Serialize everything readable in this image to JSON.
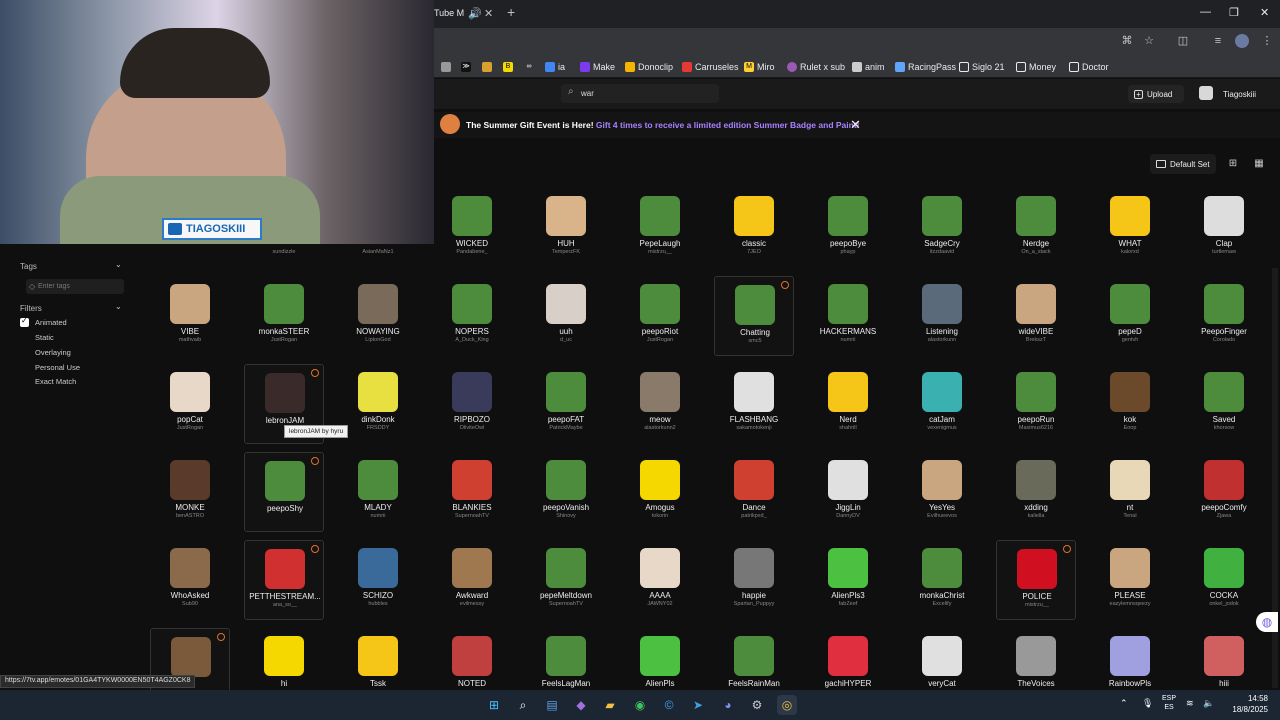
{
  "browser": {
    "tab_title": "Tube M",
    "address_icons": [
      "translate-icon",
      "star-icon",
      "extensions-icon",
      "menu-icon"
    ],
    "bookmarks": [
      {
        "label": "ia",
        "color": "#4285f4"
      },
      {
        "label": "Make",
        "color": "#7c3aed"
      },
      {
        "label": "Donoclip",
        "color": "#f5b400"
      },
      {
        "label": "Carruseles",
        "color": "#e53935"
      },
      {
        "label": "Miro",
        "color": "#ffd02f"
      },
      {
        "label": "Rulet x sub",
        "color": "#9b59b6"
      },
      {
        "label": "anim",
        "color": "#cccccc"
      },
      {
        "label": "RacingPass",
        "color": "#60a5fa"
      },
      {
        "label": "Siglo 21",
        "color": "#e8eaed"
      },
      {
        "label": "Money",
        "color": "#e8eaed"
      },
      {
        "label": "Doctor",
        "color": "#e8eaed"
      }
    ]
  },
  "header": {
    "search_value": "war",
    "upload_label": "Upload",
    "user_name": "Tiagoskiii"
  },
  "banner": {
    "title": "The Summer Gift Event is Here!",
    "link": "Gift 4 times to receive a limited edition Summer Badge and Paint!"
  },
  "toolbar": {
    "set_label": "Default Set"
  },
  "sidebar": {
    "tags_label": "Tags",
    "tags_placeholder": "Enter tags",
    "filters_label": "Filters",
    "filters": [
      {
        "label": "Animated",
        "checked": true
      },
      {
        "label": "Static",
        "checked": false
      },
      {
        "label": "Overlaying",
        "checked": false
      },
      {
        "label": "Personal Use",
        "checked": false
      },
      {
        "label": "Exact Match",
        "checked": false
      }
    ]
  },
  "emotes": [
    {
      "name": "",
      "author": "",
      "color": "#222"
    },
    {
      "name": "",
      "author": "sundizzle",
      "color": "#222"
    },
    {
      "name": "",
      "author": "AsianMaNz1",
      "color": "#222"
    },
    {
      "name": "WICKED",
      "author": "Pandabene_",
      "color": "#4c8c3c"
    },
    {
      "name": "HUH",
      "author": "TemperzFK",
      "color": "#d9b48a"
    },
    {
      "name": "PepeLaugh",
      "author": "mistrzu__",
      "color": "#4c8c3c"
    },
    {
      "name": "classic",
      "author": "7JEO",
      "color": "#f5c518"
    },
    {
      "name": "peepoBye",
      "author": "phayp",
      "color": "#4c8c3c"
    },
    {
      "name": "SadgeCry",
      "author": "itzzdaavid",
      "color": "#4c8c3c"
    },
    {
      "name": "Nerdge",
      "author": "On_a_stack",
      "color": "#4c8c3c"
    },
    {
      "name": "WHAT",
      "author": "kalorxd",
      "color": "#f5c518"
    },
    {
      "name": "Clap",
      "author": "turtlemaw",
      "color": "#dddddd"
    },
    {
      "name": "VIBE",
      "author": "mathvaib",
      "color": "#c9a680"
    },
    {
      "name": "monkaSTEER",
      "author": "JustRogan",
      "color": "#4c8c3c"
    },
    {
      "name": "NOWAYING",
      "author": "LiptonGod",
      "color": "#7a6a5a"
    },
    {
      "name": "NOPERS",
      "author": "A_Duck_King",
      "color": "#4c8c3c"
    },
    {
      "name": "uuh",
      "author": "d_uc",
      "color": "#d8d0c8"
    },
    {
      "name": "peepoRiot",
      "author": "JustRogan",
      "color": "#4c8c3c"
    },
    {
      "name": "Chatting",
      "author": "smc5",
      "color": "#4c8c3c",
      "highlight": true
    },
    {
      "name": "HACKERMANS",
      "author": "numrii",
      "color": "#4c8c3c"
    },
    {
      "name": "Listening",
      "author": "alastorkunn",
      "color": "#5a6a7a"
    },
    {
      "name": "wideVIBE",
      "author": "BrekszT",
      "color": "#c9a680"
    },
    {
      "name": "pepeD",
      "author": "gentvh",
      "color": "#4c8c3c"
    },
    {
      "name": "PeepoFinger",
      "author": "Corolado",
      "color": "#4c8c3c"
    },
    {
      "name": "popCat",
      "author": "JustRogan",
      "color": "#e8d8c8"
    },
    {
      "name": "lebronJAM",
      "author": "",
      "color": "#3a2a2a",
      "highlight": true
    },
    {
      "name": "dinkDonk",
      "author": "FRSDDY",
      "color": "#e8e040"
    },
    {
      "name": "RIPBOZO",
      "author": "OliviteOwl",
      "color": "#3a3a5a"
    },
    {
      "name": "peepoFAT",
      "author": "PatrickMaybe",
      "color": "#4c8c3c"
    },
    {
      "name": "meow",
      "author": "alastorkunn2",
      "color": "#8a7a6a"
    },
    {
      "name": "FLASHBANG",
      "author": "sakamotokenji",
      "color": "#e0e0e0"
    },
    {
      "name": "Nerd",
      "author": "shahrill",
      "color": "#f5c518"
    },
    {
      "name": "catJam",
      "author": "vexenigmus",
      "color": "#3ab0b0"
    },
    {
      "name": "peepoRun",
      "author": "Maximus6216",
      "color": "#4c8c3c"
    },
    {
      "name": "kok",
      "author": "Eoop",
      "color": "#6a4a2a"
    },
    {
      "name": "Saved",
      "author": "khorsow",
      "color": "#4c8c3c"
    },
    {
      "name": "MONKE",
      "author": "benASTRO",
      "color": "#5a3a2a"
    },
    {
      "name": "peepoShy",
      "author": "",
      "color": "#4c8c3c",
      "highlight": true
    },
    {
      "name": "MLADY",
      "author": "numrii",
      "color": "#4c8c3c"
    },
    {
      "name": "BLANKIES",
      "author": "SupernoahTV",
      "color": "#d04030"
    },
    {
      "name": "peepoVanish",
      "author": "Shinovy",
      "color": "#4c8c3c"
    },
    {
      "name": "Amogus",
      "author": "tokorin",
      "color": "#f5d800"
    },
    {
      "name": "Dance",
      "author": "patrikpxd_",
      "color": "#d04030"
    },
    {
      "name": "JiggLin",
      "author": "DannyDV",
      "color": "#e0e0e0"
    },
    {
      "name": "YesYes",
      "author": "Evilhueevos",
      "color": "#c9a680"
    },
    {
      "name": "xdding",
      "author": "kaliella",
      "color": "#6a6a5a"
    },
    {
      "name": "nt",
      "author": "Tenal",
      "color": "#e8d8b8"
    },
    {
      "name": "peepoComfy",
      "author": "Zjawa",
      "color": "#c03030"
    },
    {
      "name": "WhoAsked",
      "author": "Sub90",
      "color": "#8a6a4a"
    },
    {
      "name": "PETTHESTREAM...",
      "author": "ana_so__",
      "color": "#d03030",
      "highlight": true
    },
    {
      "name": "SCHIZO",
      "author": "hubbles",
      "color": "#3a6a9a"
    },
    {
      "name": "Awkward",
      "author": "evilmessy",
      "color": "#a07850"
    },
    {
      "name": "pepeMeltdown",
      "author": "SupernoahTV",
      "color": "#4c8c3c"
    },
    {
      "name": "AAAA",
      "author": "JAWNY02",
      "color": "#e8d8c8"
    },
    {
      "name": "happie",
      "author": "Spartan_Puppyy",
      "color": "#777777"
    },
    {
      "name": "AlienPls3",
      "author": "fabZeef",
      "color": "#4cc040"
    },
    {
      "name": "monkaChrist",
      "author": "Excelify",
      "color": "#4c8c3c"
    },
    {
      "name": "POLICE",
      "author": "mistrzu__",
      "color": "#d01020",
      "highlight": true
    },
    {
      "name": "PLEASE",
      "author": "eazylemnsqeezy",
      "color": "#c9a680"
    },
    {
      "name": "COCKA",
      "author": "onkel_jodok",
      "color": "#40b040"
    },
    {
      "name": "",
      "author": "",
      "color": "#7a5a3a",
      "highlight": true
    },
    {
      "name": "hi",
      "author": "",
      "color": "#f5d800"
    },
    {
      "name": "Tssk",
      "author": "",
      "color": "#f5c518"
    },
    {
      "name": "NOTED",
      "author": "",
      "color": "#c04040"
    },
    {
      "name": "FeelsLagMan",
      "author": "",
      "color": "#4c8c3c"
    },
    {
      "name": "AlienPls",
      "author": "",
      "color": "#4cc040"
    },
    {
      "name": "FeelsRainMan",
      "author": "",
      "color": "#4c8c3c"
    },
    {
      "name": "gachiHYPER",
      "author": "",
      "color": "#e03040"
    },
    {
      "name": "veryCat",
      "author": "",
      "color": "#e0e0e0"
    },
    {
      "name": "TheVoices",
      "author": "",
      "color": "#999999"
    },
    {
      "name": "RainbowPls",
      "author": "",
      "color": "#a0a0e0"
    },
    {
      "name": "hiii",
      "author": "",
      "color": "#d06060"
    }
  ],
  "clock_icons": [
    18,
    25,
    37,
    49,
    57,
    60
  ],
  "tooltip": "lebronJAM by hyru",
  "webcam": {
    "label": "TIAGOSKIII"
  },
  "status_url": "https://7tv.app/emotes/01GA4TYKW0000EN50T4AGZ0CK8",
  "taskbar": {
    "icons": [
      "windows-icon",
      "search-icon",
      "notepad-icon",
      "app-icon",
      "explorer-icon",
      "whatsapp-icon",
      "clock-icon",
      "telegram-icon",
      "discord-icon",
      "steam-icon",
      "chrome-icon"
    ],
    "lang_top": "ESP",
    "lang_bottom": "ES",
    "time": "14:58",
    "date": "18/8/2025"
  }
}
